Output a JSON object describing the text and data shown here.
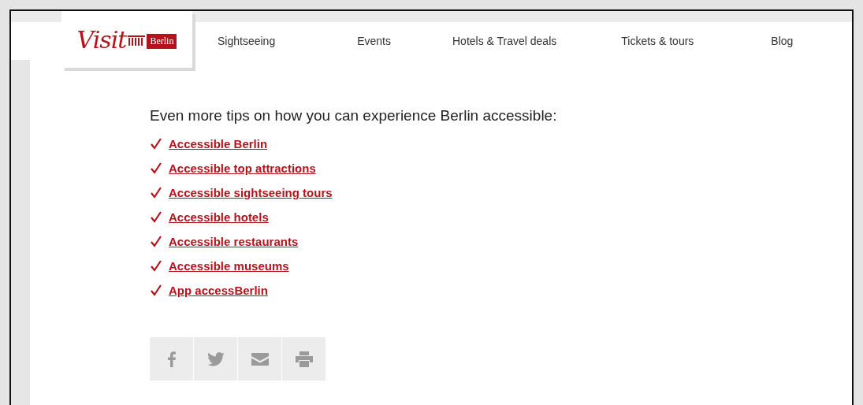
{
  "logo": {
    "script": "Visit",
    "city": "Berlin"
  },
  "nav": [
    {
      "label": "Sightseeing"
    },
    {
      "label": "Events"
    },
    {
      "label": "Hotels & Travel deals"
    },
    {
      "label": "Tickets & tours"
    },
    {
      "label": "Blog"
    }
  ],
  "heading": "Even more tips on how you can experience Berlin accessible:",
  "links": [
    {
      "label": "Accessible Berlin"
    },
    {
      "label": "Accessible top attractions"
    },
    {
      "label": "Accessible sightseeing tours"
    },
    {
      "label": "Accessible hotels"
    },
    {
      "label": "Accessible restaurants"
    },
    {
      "label": "Accessible museums"
    },
    {
      "label": "App accessBerlin"
    }
  ],
  "share": [
    {
      "kind": "facebook"
    },
    {
      "kind": "twitter"
    },
    {
      "kind": "mail"
    },
    {
      "kind": "print"
    }
  ]
}
